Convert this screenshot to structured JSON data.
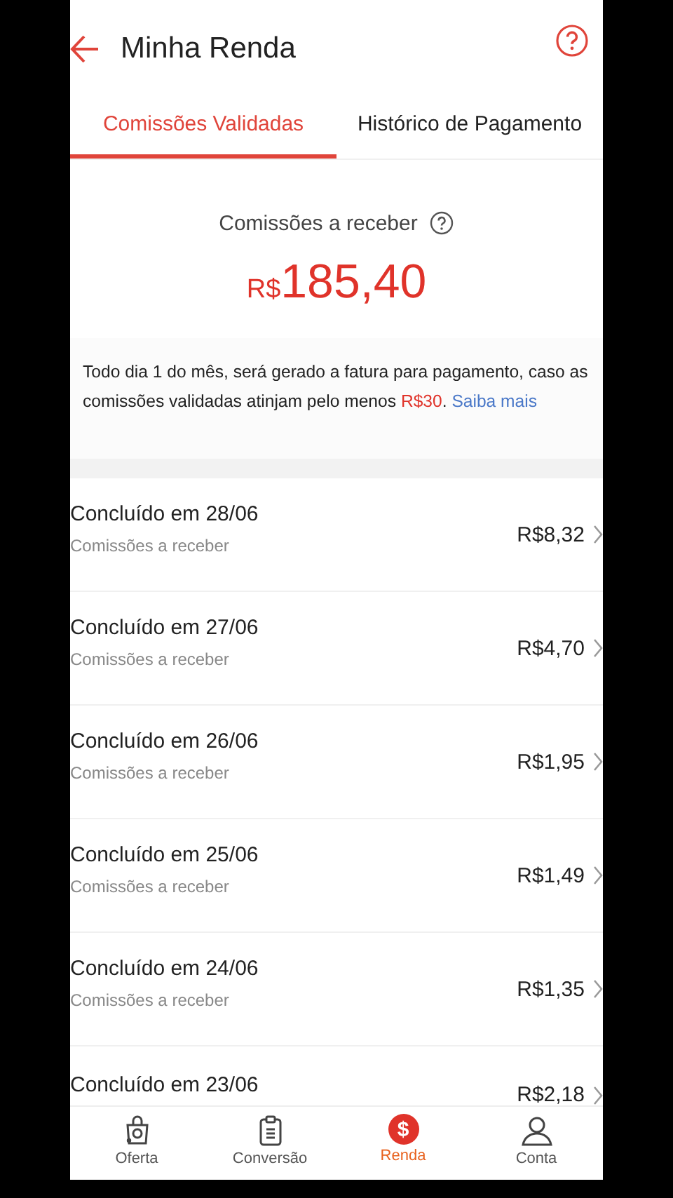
{
  "header": {
    "title": "Minha Renda"
  },
  "tabs": [
    {
      "label": "Comissões Validadas",
      "selected": true
    },
    {
      "label": "Histórico de Pagamento",
      "selected": false
    }
  ],
  "summary": {
    "label": "Comissões a receber",
    "currency": "R$",
    "amount": "185,40"
  },
  "note": {
    "text": "Todo dia 1 do mês, será gerado a fatura para pagamento, caso as comissões validadas atinjam pelo menos ",
    "highlight": "R$30",
    "after": ".",
    "link": "Saiba mais"
  },
  "entries": [
    {
      "title": "Concluído em 28/06",
      "subtitle": "Comissões a receber",
      "amount": "R$8,32"
    },
    {
      "title": "Concluído em 27/06",
      "subtitle": "Comissões a receber",
      "amount": "R$4,70"
    },
    {
      "title": "Concluído em 26/06",
      "subtitle": "Comissões a receber",
      "amount": "R$1,95"
    },
    {
      "title": "Concluído em 25/06",
      "subtitle": "Comissões a receber",
      "amount": "R$1,49"
    },
    {
      "title": "Concluído em 24/06",
      "subtitle": "Comissões a receber",
      "amount": "R$1,35"
    },
    {
      "title": "Concluído em 23/06",
      "amount": "R$2,18"
    }
  ],
  "nav": [
    {
      "label": "Oferta",
      "selected": false
    },
    {
      "label": "Conversão",
      "selected": false
    },
    {
      "label": "Renda",
      "selected": true,
      "glyph": "$"
    },
    {
      "label": "Conta",
      "selected": false
    }
  ]
}
